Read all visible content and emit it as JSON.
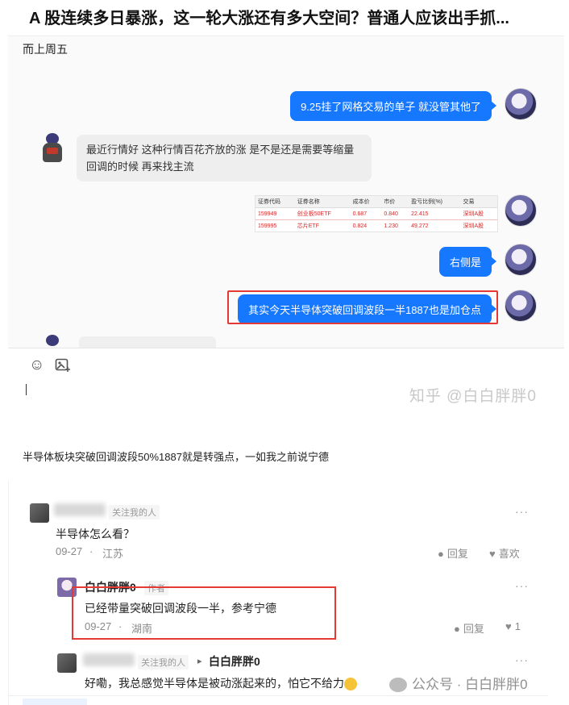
{
  "page_title": "A 股连续多日暴涨，这一轮大涨还有多大空间？普通人应该出手抓...",
  "screenshot": {
    "lead_text": "而上周五",
    "messages": [
      {
        "side": "right",
        "text": "9.25挂了网格交易的单子 就没管其他了"
      },
      {
        "side": "left",
        "text": "最近行情好 这种行情百花齐放的涨 是不是还是需要等缩量回调的时候 再来找主流"
      },
      {
        "side": "right",
        "text": "右侧是"
      },
      {
        "side": "right",
        "text": "其实今天半导体突破回调波段一半1887也是加仓点"
      }
    ],
    "table": {
      "headers": [
        "证券代码",
        "证券名称",
        "成本价",
        "市价",
        "盈亏比例(%)",
        "交易"
      ],
      "rows": [
        [
          "159949",
          "创业板50ETF",
          "0.687",
          "0.840",
          "22.415",
          "深圳A股"
        ],
        [
          "159995",
          "芯片ETF",
          "0.824",
          "1.230",
          "49.272",
          "深圳A股"
        ]
      ]
    },
    "toolbar": {
      "emoji_icon": "smile-icon",
      "image_icon": "image-add-icon"
    },
    "watermark": "知乎 @白白胖胖0"
  },
  "paragraph": "半导体板块突破回调波段50%1887就是转强点，一如我之前说宁德",
  "comments": {
    "c1": {
      "tag": "关注我的人",
      "text": "半导体怎么看？",
      "date": "09-27",
      "location": "江苏",
      "reply_label": "回复",
      "like_label": "喜欢",
      "more": "···"
    },
    "c2": {
      "name": "白白胖胖0",
      "tag": "作者",
      "text": "已经带量突破回调波段一半，参考宁德",
      "date": "09-27",
      "location": "湖南",
      "reply_label": "回复",
      "like_count": "1",
      "more": "···"
    },
    "c3": {
      "tag": "关注我的人",
      "arrow": "▸",
      "reply_to": "白白胖胖0",
      "text": "好嘞，我总感觉半导体是被动涨起来的，怕它不给力",
      "more": "···"
    },
    "wechat_watermark": "公众号 · 白白胖胖0"
  }
}
